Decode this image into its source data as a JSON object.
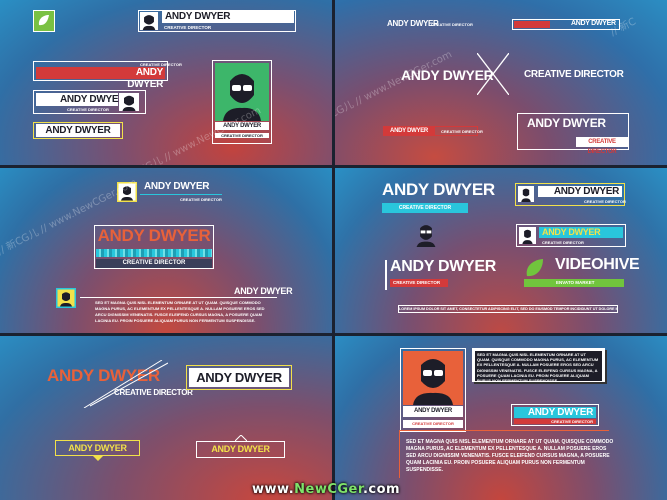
{
  "name": "ANDY DWYER",
  "role": "CREATIVE DIRECTOR",
  "role_two_line": "CREATIVE\nDIRECTOR",
  "brand": "VIDEOHIVE",
  "brand_sub": "ENVATO MARKET",
  "lorem_block": "SED ET MAGNA QUIS NISL ELEMENTUM ORNARE AT UT QUAM. QUISQUE COMMODO MAGNA PURUS, AC ELEMENTUM EX PELLENTESQUE A. NULLAM POSUERE EROS SED ARCU DIGNISSIM VENENATIS. FUSCE ELEIFEND CURSUS MAGNA, A POSUERE QUAM LACINIA EU. PROIN POSUERE ALIQUAM PURUS NON FERMENTUM SUSPENDISSE.",
  "lorem_line": "LOREM IPSUM DOLOR SIT AMET, CONSECTETUR ADIPISCING ELIT, SED DO EIUSMOD TEMPOR INCIDIDUNT UT DOLORE MAGNA ALIQUA.",
  "watermark": "// 新CG儿 // www.NewCGer.com",
  "watermark_partial": "// 新C",
  "site_watermark": {
    "prefix": "www.",
    "accent": "NewCGer",
    "suffix": ".com"
  },
  "colors": {
    "red": "#d33a3a",
    "cyan": "#29c6dc",
    "yellow": "#f2e14a",
    "green": "#71c53d",
    "orange": "#e8613a",
    "navy": "#1d1d28"
  }
}
